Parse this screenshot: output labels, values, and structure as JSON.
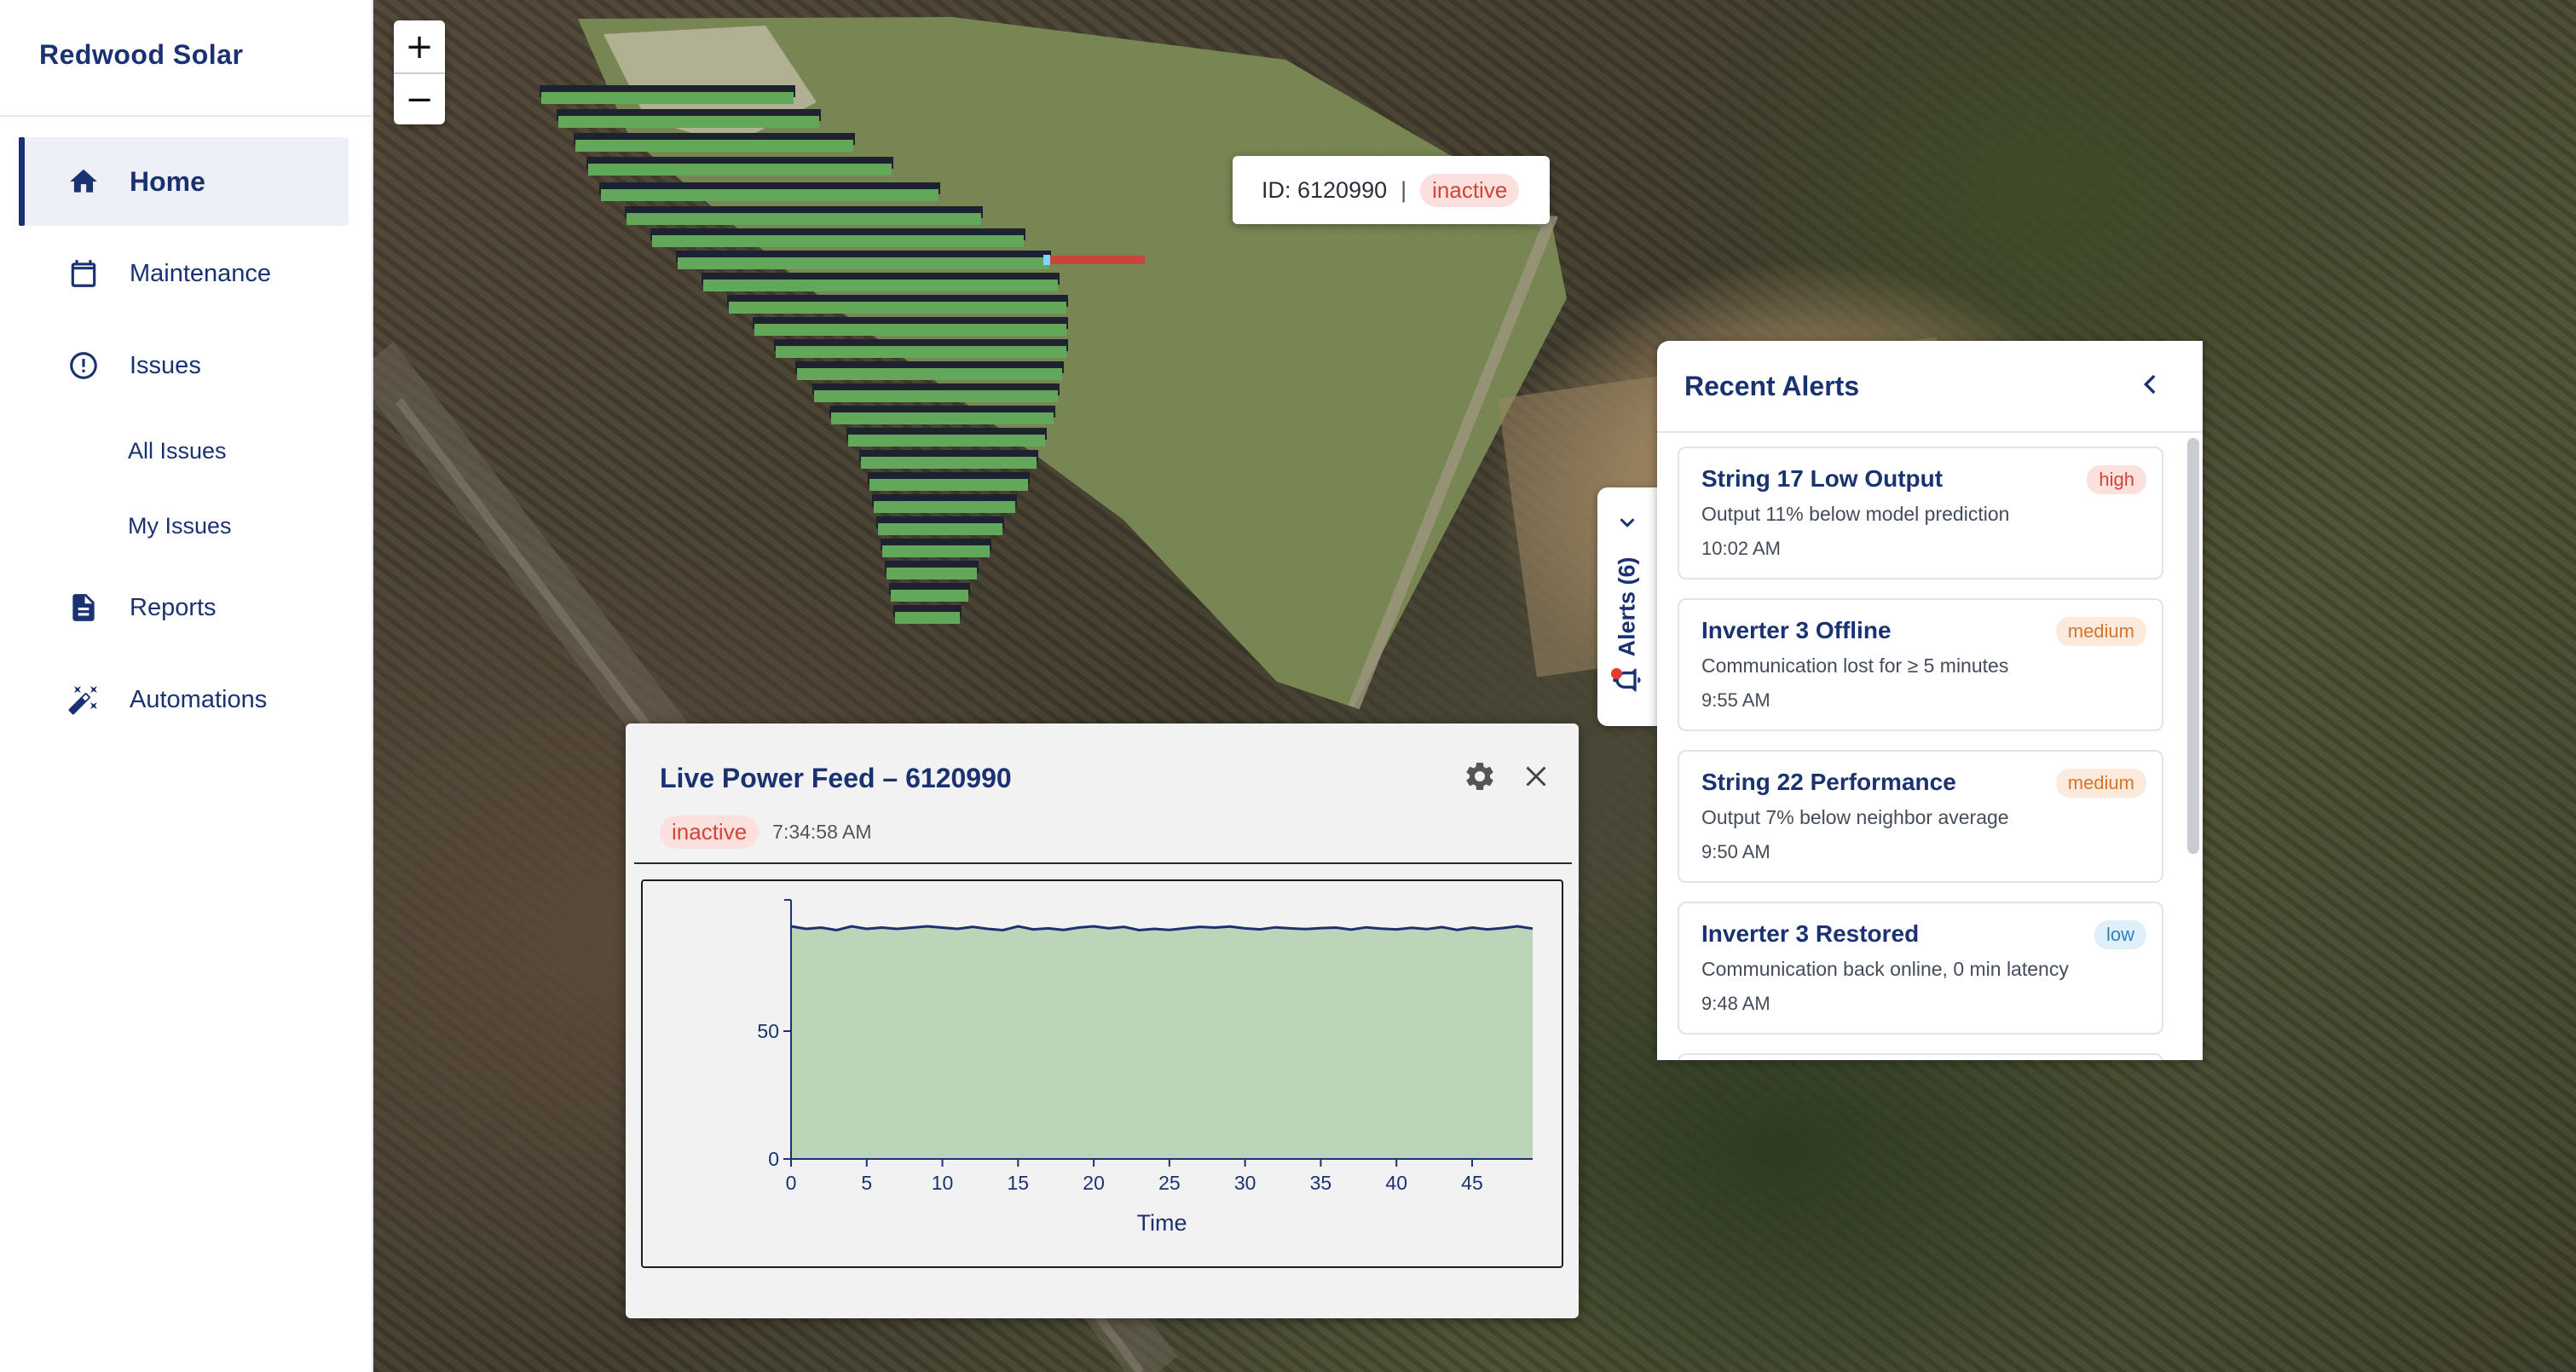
{
  "app": {
    "title": "Redwood Solar"
  },
  "sidebar": {
    "items": [
      {
        "label": "Home",
        "icon": "home-icon",
        "active": true
      },
      {
        "label": "Maintenance",
        "icon": "calendar-icon"
      },
      {
        "label": "Issues",
        "icon": "alert-circle-icon"
      },
      {
        "label": "All Issues",
        "sub": true
      },
      {
        "label": "My Issues",
        "sub": true
      },
      {
        "label": "Reports",
        "icon": "document-icon"
      },
      {
        "label": "Automations",
        "icon": "magic-wand-icon"
      }
    ]
  },
  "map": {
    "zoom_in": "+",
    "zoom_out": "−",
    "tooltip": {
      "id_text": "ID: 6120990",
      "separator": "|",
      "status": "inactive"
    }
  },
  "alerts_tab": {
    "label": "Alerts (6)"
  },
  "alerts_panel": {
    "title": "Recent Alerts",
    "alerts": [
      {
        "title": "String 17 Low Output",
        "severity": "high",
        "description": "Output 11% below model prediction",
        "time": "10:02 AM"
      },
      {
        "title": "Inverter 3 Offline",
        "severity": "medium",
        "description": "Communication lost for ≥ 5 minutes",
        "time": "9:55 AM"
      },
      {
        "title": "String 22 Performance",
        "severity": "medium",
        "description": "Output 7% below neighbor average",
        "time": "9:50 AM"
      },
      {
        "title": "Inverter 3 Restored",
        "severity": "low",
        "description": "Communication back online, 0 min latency",
        "time": "9:48 AM"
      }
    ]
  },
  "feed": {
    "title": "Live Power Feed – 6120990",
    "status": "inactive",
    "time": "7:34:58 AM"
  },
  "colors": {
    "brand": "#1b3272",
    "inactive": "#d24535",
    "high": "#d24535",
    "medium": "#d8742a",
    "low": "#2d7fc1",
    "area_fill": "#bcd4b8",
    "panel_green": "#63a85a",
    "panel_red": "#c8453b"
  },
  "chart_data": {
    "type": "area",
    "title": "",
    "xlabel": "Time",
    "ylabel": "",
    "xlim": [
      0,
      49
    ],
    "ylim": [
      0,
      100
    ],
    "x_ticks": [
      0,
      5,
      10,
      15,
      20,
      25,
      30,
      35,
      40,
      45
    ],
    "y_ticks": [
      0,
      50
    ],
    "grid": false,
    "x": [
      0,
      1,
      2,
      3,
      4,
      5,
      6,
      7,
      8,
      9,
      10,
      11,
      12,
      13,
      14,
      15,
      16,
      17,
      18,
      19,
      20,
      21,
      22,
      23,
      24,
      25,
      26,
      27,
      28,
      29,
      30,
      31,
      32,
      33,
      34,
      35,
      36,
      37,
      38,
      39,
      40,
      41,
      42,
      43,
      44,
      45,
      46,
      47,
      48,
      49
    ],
    "values": [
      91,
      90,
      90.5,
      89.5,
      91,
      90,
      90.5,
      90,
      90.5,
      91,
      90.5,
      90,
      90.8,
      90,
      89.5,
      91,
      89.8,
      90.2,
      89.6,
      90.5,
      91,
      90.2,
      90.8,
      89.5,
      90,
      89.6,
      90.2,
      90.8,
      90.5,
      90.9,
      90.2,
      89.8,
      90.6,
      90.2,
      89.9,
      90.3,
      90.5,
      89.7,
      90.6,
      90.1,
      89.8,
      90.4,
      89.9,
      90.7,
      89.6,
      90.5,
      89.8,
      90.3,
      91,
      90.1
    ]
  }
}
